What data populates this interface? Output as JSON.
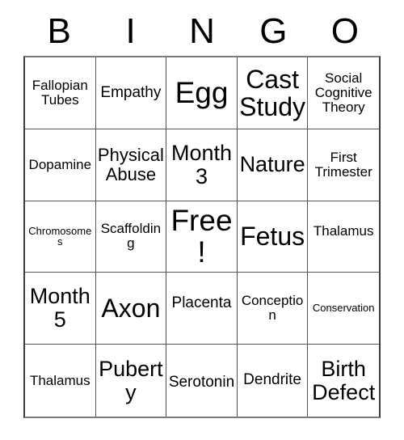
{
  "card": {
    "title": "BINGO",
    "header_letters": [
      "B",
      "I",
      "N",
      "G",
      "O"
    ],
    "free_space_label": "Free!",
    "colors": {
      "background": "#ffffff",
      "text": "#000000",
      "grid_line": "#555555",
      "grid_border": "#3d3d3d"
    },
    "rows": [
      [
        {
          "text": "Fallopian\nTubes",
          "size": "fs-sm",
          "nudge": ""
        },
        {
          "text": "Empathy",
          "size": "fs-md",
          "nudge": ""
        },
        {
          "text": "Egg",
          "size": "fs-huge",
          "nudge": ""
        },
        {
          "text": "Cast\nStudy",
          "size": "fs-xxl",
          "nudge": ""
        },
        {
          "text": "Social\nCognitive\nTheory",
          "size": "fs-sm",
          "nudge": ""
        }
      ],
      [
        {
          "text": "Dopamine",
          "size": "fs-sm",
          "nudge": ""
        },
        {
          "text": "Physical\nAbuse",
          "size": "fs-lg",
          "nudge": ""
        },
        {
          "text": "Month\n3",
          "size": "fs-xl",
          "nudge": ""
        },
        {
          "text": "Nature",
          "size": "fs-xl",
          "nudge": ""
        },
        {
          "text": "First\nTrimester",
          "size": "fs-sm",
          "nudge": ""
        }
      ],
      [
        {
          "text": "Chromosomes",
          "size": "fs-xs",
          "nudge": ""
        },
        {
          "text": "Scaffolding",
          "size": "fs-sm",
          "nudge": ""
        },
        {
          "text": "Free!",
          "size": "fs-huge",
          "nudge": ""
        },
        {
          "text": "Fetus",
          "size": "fs-xxl",
          "nudge": ""
        },
        {
          "text": "Thalamus",
          "size": "fs-sm",
          "nudge": "nudge-up"
        }
      ],
      [
        {
          "text": "Month\n5",
          "size": "fs-xl",
          "nudge": ""
        },
        {
          "text": "Axon",
          "size": "fs-xxl",
          "nudge": ""
        },
        {
          "text": "Placenta",
          "size": "fs-md",
          "nudge": "nudge-up"
        },
        {
          "text": "Conception",
          "size": "fs-sm",
          "nudge": ""
        },
        {
          "text": "Conservation",
          "size": "fs-xs",
          "nudge": ""
        }
      ],
      [
        {
          "text": "Thalamus",
          "size": "fs-sm",
          "nudge": ""
        },
        {
          "text": "Puberty",
          "size": "fs-xl",
          "nudge": ""
        },
        {
          "text": "Serotonin",
          "size": "fs-md",
          "nudge": "nudge-down"
        },
        {
          "text": "Dendrite",
          "size": "fs-md",
          "nudge": ""
        },
        {
          "text": "Birth\nDefect",
          "size": "fs-xl",
          "nudge": ""
        }
      ]
    ]
  }
}
